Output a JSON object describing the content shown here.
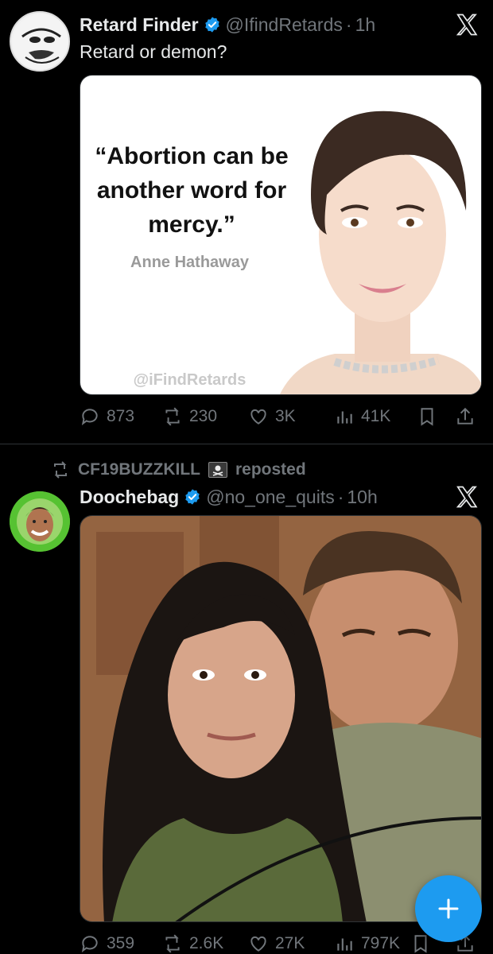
{
  "tweets": [
    {
      "display_name": "Retard Finder",
      "handle": "@IfindRetards",
      "time": "1h",
      "text": "Retard or demon?",
      "avatar_icon": "meme-face-icon",
      "media": {
        "quote": "“Abortion can be another word for mercy.”",
        "quote_lines": [
          "“Abortion can be",
          "another word for",
          "mercy.”"
        ],
        "author": "Anne Hathaway",
        "watermark": "@iFindRetards"
      },
      "stats": {
        "replies": "873",
        "reposts": "230",
        "likes": "3K",
        "views": "41K"
      }
    },
    {
      "repost_by": "CF19BUZZKILL",
      "repost_suffix": "reposted",
      "display_name": "Doochebag",
      "handle": "@no_one_quits",
      "time": "10h",
      "avatar_icon": "smiling-man-avatar",
      "stats": {
        "replies": "359",
        "reposts": "2.6K",
        "likes": "27K",
        "views": "797K"
      }
    }
  ],
  "colors": {
    "background": "#000000",
    "text": "#e7e9ea",
    "muted": "#71767b",
    "accent": "#1d9bf0",
    "divider": "#2f3336"
  },
  "fab": {
    "icon": "plus-icon"
  }
}
